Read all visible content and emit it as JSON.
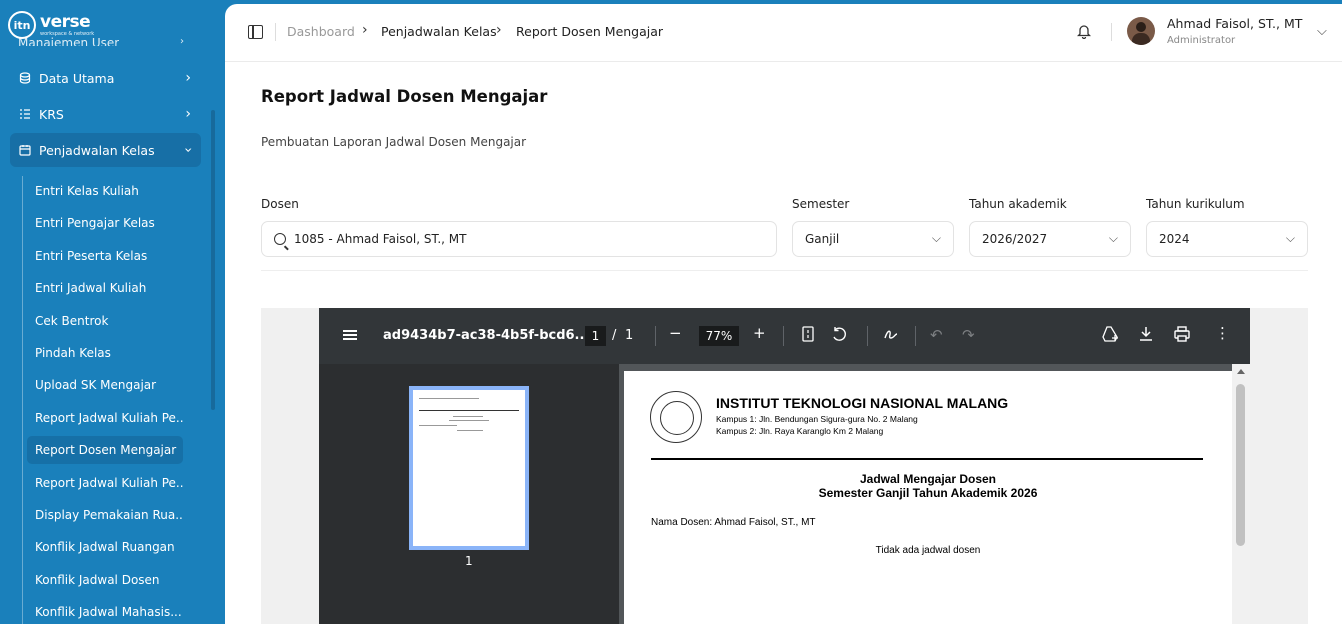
{
  "brand": {
    "mark": "itn",
    "name": "verse",
    "tagline": "workspace & network"
  },
  "sidebar": {
    "clipped_item": "Manajemen User",
    "items": [
      {
        "label": "Data Utama"
      },
      {
        "label": "KRS"
      },
      {
        "label": "Penjadwalan Kelas"
      }
    ],
    "subitems": [
      {
        "label": "Entri Kelas Kuliah"
      },
      {
        "label": "Entri Pengajar Kelas"
      },
      {
        "label": "Entri Peserta Kelas"
      },
      {
        "label": "Entri Jadwal Kuliah"
      },
      {
        "label": "Cek Bentrok"
      },
      {
        "label": "Pindah Kelas"
      },
      {
        "label": "Upload SK Mengajar"
      },
      {
        "label": "Report Jadwal Kuliah Pe..."
      },
      {
        "label": "Report Dosen Mengajar"
      },
      {
        "label": "Report Jadwal Kuliah Pe..."
      },
      {
        "label": "Display Pemakaian Rua..."
      },
      {
        "label": "Konflik Jadwal Ruangan"
      },
      {
        "label": "Konflik Jadwal Dosen"
      },
      {
        "label": "Konflik Jadwal Mahasis..."
      }
    ]
  },
  "breadcrumb": {
    "home": "Dashboard",
    "section": "Penjadwalan Kelas",
    "current": "Report Dosen Mengajar"
  },
  "user": {
    "name": "Ahmad Faisol, ST., MT",
    "role": "Administrator"
  },
  "page": {
    "title": "Report Jadwal Dosen Mengajar",
    "subtitle": "Pembuatan Laporan Jadwal Dosen Mengajar"
  },
  "filters": {
    "dosen": {
      "label": "Dosen",
      "value": "1085 - Ahmad Faisol, ST., MT"
    },
    "semester": {
      "label": "Semester",
      "value": "Ganjil"
    },
    "tahun_akademik": {
      "label": "Tahun akademik",
      "value": "2026/2027"
    },
    "tahun_kurikulum": {
      "label": "Tahun kurikulum",
      "value": "2024"
    }
  },
  "pdf": {
    "filename": "ad9434b7-ac38-4b5f-bcd6...",
    "page_current": "1",
    "page_sep": "/",
    "page_total": "1",
    "zoom": "77%",
    "thumb_label": "1",
    "doc": {
      "institution": "INSTITUT TEKNOLOGI NASIONAL MALANG",
      "campus1": "Kampus 1: Jln. Bendungan Sigura-gura No. 2 Malang",
      "campus2": "Kampus 2: Jln. Raya Karanglo Km 2 Malang",
      "title1": "Jadwal Mengajar Dosen",
      "title2": "Semester Ganjil Tahun Akademik 2026",
      "lecturer": "Nama Dosen: Ahmad Faisol, ST., MT",
      "empty": "Tidak ada jadwal dosen"
    }
  }
}
